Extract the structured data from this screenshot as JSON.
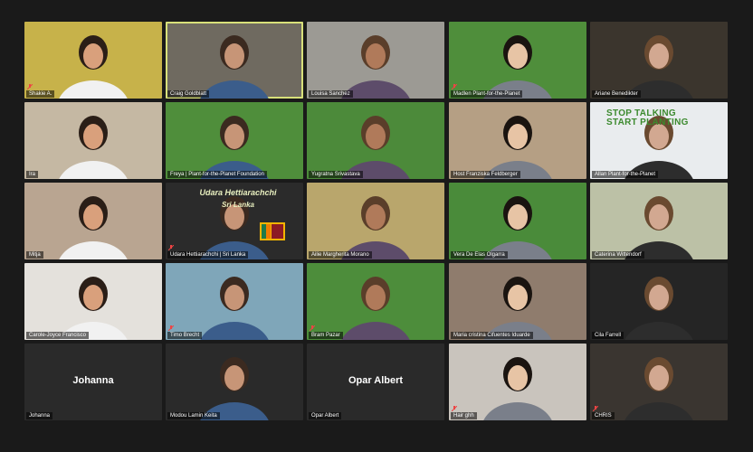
{
  "meeting": {
    "participants": [
      {
        "name": "Shakie A.",
        "bg": "#c7b24a",
        "muted": true
      },
      {
        "name": "Craig Goldblatt",
        "bg": "#6f6a60",
        "muted": false,
        "active": true
      },
      {
        "name": "Louisa Sanchez",
        "bg": "#9c9a94",
        "muted": false
      },
      {
        "name": "Madlen Plant-for-the-Planet",
        "bg": "#4f8e3b",
        "muted": true
      },
      {
        "name": "Ariane Benedikter",
        "bg": "#3b352d",
        "muted": false
      },
      {
        "name": "Ira",
        "bg": "#c5b8a3",
        "muted": false
      },
      {
        "name": "Freya | Plant-for-the-Planet Foundation",
        "bg": "#4f8e3b",
        "muted": false
      },
      {
        "name": "Yugratna Srivastava",
        "bg": "#4c8a3a",
        "muted": false
      },
      {
        "name": "Host Franziska Feldberger",
        "bg": "#b59f84",
        "muted": false
      },
      {
        "name": "Allan Plant-for-the-Planet",
        "bg": "#e9ecee",
        "muted": false
      },
      {
        "name": "Mitja",
        "bg": "#b9a591",
        "muted": false
      },
      {
        "name": "Udara Hettiarachchi | Sri Lanka",
        "bg": "#2b2b2b",
        "muted": true
      },
      {
        "name": "Ailie Margherita Morano",
        "bg": "#b9a66c",
        "muted": false
      },
      {
        "name": "Vera De Elas Olgarra",
        "bg": "#4a8b3a",
        "muted": false
      },
      {
        "name": "Caterina Wittendorf",
        "bg": "#bcc1a6",
        "muted": false
      },
      {
        "name": "Carole-Joyce Francisco",
        "bg": "#e4e1dc",
        "muted": false
      },
      {
        "name": "Timo Brecht",
        "bg": "#7fa6b9",
        "muted": true
      },
      {
        "name": "Bram Pazar",
        "bg": "#4d8d3b",
        "muted": true
      },
      {
        "name": "Maria cristina Cifuentes Iduarde",
        "bg": "#8f7c6d",
        "muted": false
      },
      {
        "name": "Cila Farrell",
        "bg": "#252525",
        "muted": false
      },
      {
        "name": "Johanna",
        "bg": "#2a2a2a",
        "muted": false,
        "avatarOff": true
      },
      {
        "name": "Modou Lamin Keita",
        "bg": "#2a2a2a",
        "muted": false
      },
      {
        "name": "Opar Albert",
        "bg": "#2a2a2a",
        "muted": false,
        "avatarOff": true
      },
      {
        "name": "Hair ghh",
        "bg": "#c9c4bd",
        "muted": true
      },
      {
        "name": "CHRIS",
        "bg": "#3a3530",
        "muted": true
      }
    ],
    "overlay": {
      "udara_title": "Udara Hettiarachchi",
      "udara_sub": "Sri Lanka",
      "banner": "STOP TALKING START PLANTING",
      "bigname_1": "Johanna",
      "bigname_2": "Opar Albert"
    }
  }
}
